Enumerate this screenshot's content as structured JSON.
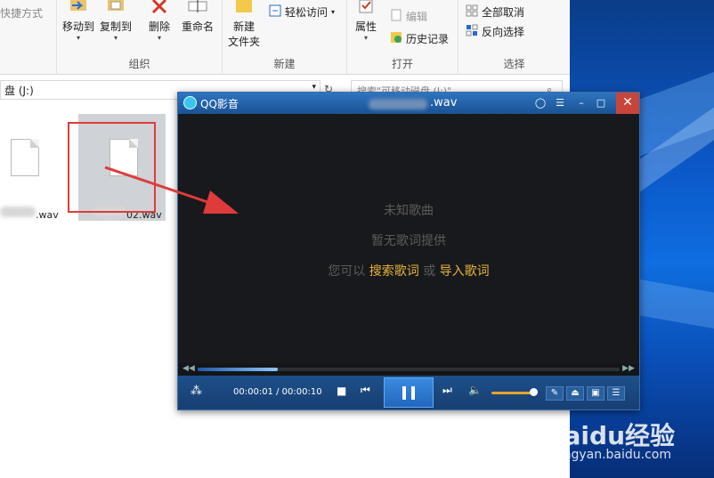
{
  "ribbon": {
    "quick_access": "快捷方式",
    "move_to": "移动到",
    "copy_to": "复制到",
    "delete": "删除",
    "rename": "重命名",
    "new_folder_line1": "新建",
    "new_folder_line2": "文件夹",
    "easy_access": "轻松访问",
    "properties": "属性",
    "edit": "编辑",
    "history": "历史记录",
    "select_none": "全部取消",
    "invert_selection": "反向选择",
    "group_organize": "组织",
    "group_new": "新建",
    "group_open": "打开",
    "group_select": "选择"
  },
  "address": {
    "path": "盘 (J:)",
    "search_placeholder": "搜索\"可移动磁盘 (J:)\""
  },
  "files": [
    {
      "name": ".wav"
    },
    {
      "name": "02.wav"
    }
  ],
  "player": {
    "app_name": "QQ影音",
    "file_title": ".wav",
    "unknown_song": "未知歌曲",
    "no_lyrics": "暂无歌词提供",
    "you_can": "您可以",
    "search_lyrics": "搜索歌词",
    "or": "或",
    "import_lyrics": "导入歌词",
    "time": "00:00:01 / 00:00:10",
    "progress": 0.19,
    "volume": 0.85
  },
  "watermark": {
    "brand": "Baidu经验",
    "url": "jingyan.baidu.com"
  }
}
